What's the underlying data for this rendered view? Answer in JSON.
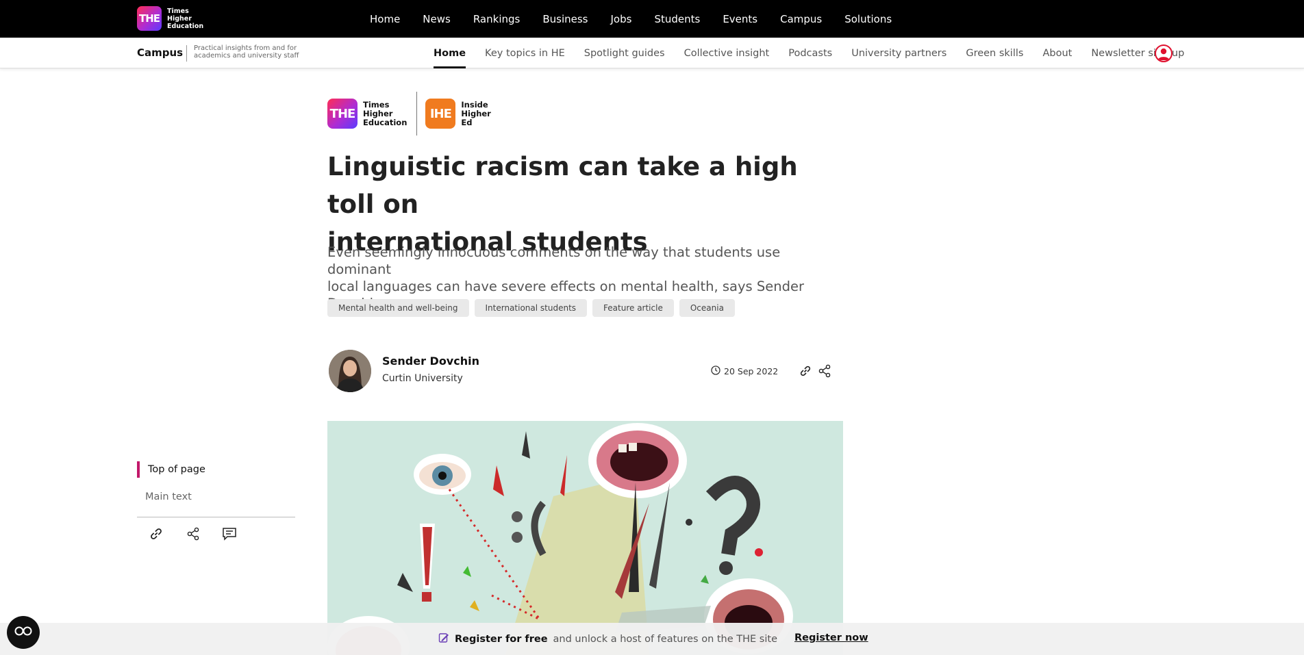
{
  "topnav": {
    "logo_text": [
      "Times",
      "Higher",
      "Education"
    ],
    "logo_mark": "THE",
    "items": [
      {
        "label": "Home"
      },
      {
        "label": "News"
      },
      {
        "label": "Rankings"
      },
      {
        "label": "Business"
      },
      {
        "label": "Jobs"
      },
      {
        "label": "Students"
      },
      {
        "label": "Events"
      },
      {
        "label": "Campus"
      },
      {
        "label": "Solutions"
      }
    ]
  },
  "subnav": {
    "section_title": "Campus",
    "tagline_line1": "Practical insights from and for",
    "tagline_line2": "academics and university staff",
    "items": [
      {
        "label": "Home",
        "active": true
      },
      {
        "label": "Key topics in HE"
      },
      {
        "label": "Spotlight guides"
      },
      {
        "label": "Collective insight"
      },
      {
        "label": "Podcasts"
      },
      {
        "label": "University partners"
      },
      {
        "label": "Green skills"
      },
      {
        "label": "About"
      },
      {
        "label": "Newsletter sign up"
      }
    ],
    "user_icon": "user-account-icon"
  },
  "article": {
    "brand_logos": [
      {
        "mark": "THE",
        "words": [
          "Times",
          "Higher",
          "Education"
        ]
      },
      {
        "mark": "IHE",
        "words": [
          "Inside",
          "Higher",
          "Ed"
        ]
      }
    ],
    "headline_line1": "Linguistic racism can take a high toll on",
    "headline_line2": "international students",
    "standfirst_line1": "Even seemingly innocuous comments on the way that students use dominant",
    "standfirst_line2": "local languages can have severe effects on mental health, says Sender Dovchin",
    "tags": [
      "Mental health and well-being",
      "International students",
      "Feature article",
      "Oceania"
    ],
    "author": {
      "name": "Sender Dovchin",
      "affiliation": "Curtin University"
    },
    "date": "20 Sep 2022"
  },
  "toc": {
    "items": [
      {
        "label": "Top of page",
        "active": true
      },
      {
        "label": "Main text"
      }
    ],
    "icons": [
      "link-icon",
      "share-icon",
      "comment-icon"
    ]
  },
  "register_bar": {
    "bold": "Register for free",
    "rest": "and unlock a host of features on the THE site",
    "link": "Register now"
  },
  "colors": {
    "topbar": "#000000",
    "accent": "#c2186a",
    "ihe_orange": "#f07b1f",
    "user_red": "#e0102e"
  }
}
